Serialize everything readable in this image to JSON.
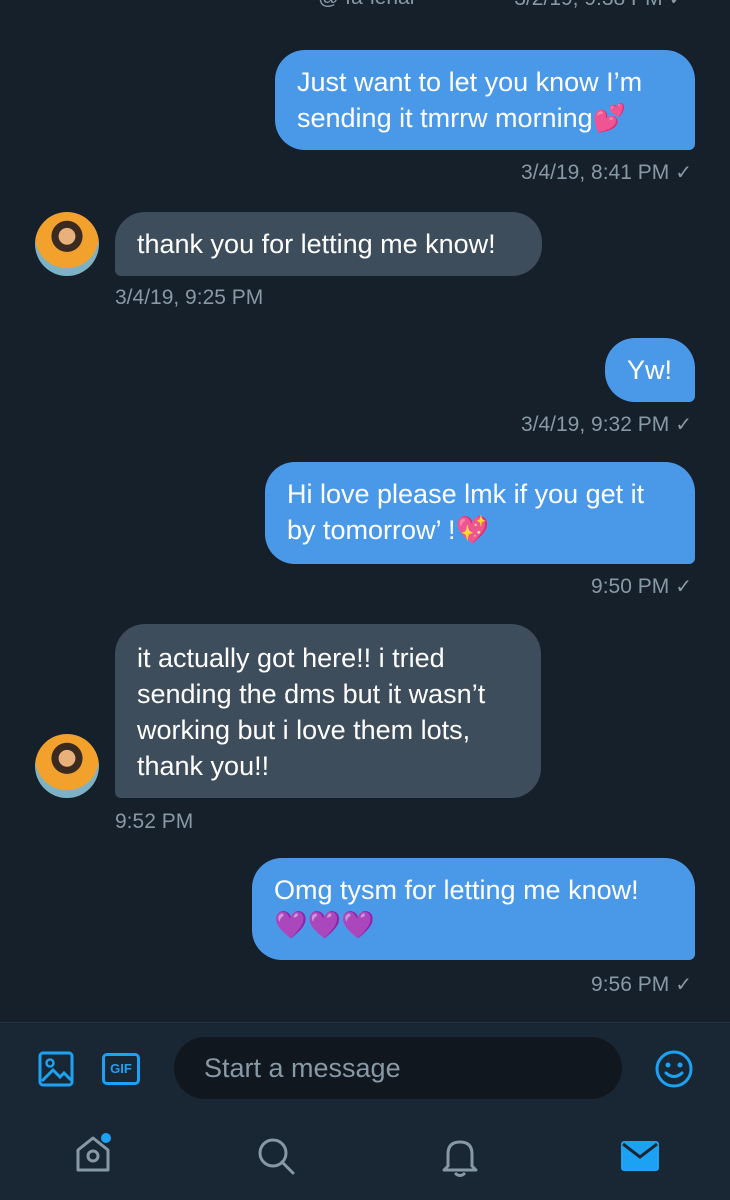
{
  "header": {
    "handle_partial": "@ fa•ienal",
    "prev_time_partial": "3/2/19, 9:38 PM ✓"
  },
  "messages": [
    {
      "direction": "out",
      "text": "Just want to let you know I’m sending it tmrrw morning",
      "emoji": "💕",
      "meta": "3/4/19, 8:41 PM"
    },
    {
      "direction": "in",
      "text": "thank you for letting me know!",
      "meta": "3/4/19, 9:25 PM"
    },
    {
      "direction": "out",
      "text": "Yw!",
      "meta": "3/4/19, 9:32 PM"
    },
    {
      "direction": "out",
      "text": "Hi love please lmk if you get it by tomorrow’ !",
      "emoji": "💖",
      "meta": "9:50 PM"
    },
    {
      "direction": "in",
      "text": "it actually got here!! i tried sending the dms but it wasn’t working but i love them lots, thank you!!",
      "meta": "9:52 PM"
    },
    {
      "direction": "out",
      "text": "Omg tysm for letting me know!",
      "emoji": "💜💜💜",
      "meta": "9:56 PM"
    }
  ],
  "read_check": "✓",
  "composer": {
    "placeholder": "Start a message",
    "gif_label": "GIF"
  },
  "colors": {
    "background": "#15202b",
    "outgoing_bubble": "#4a99e9",
    "incoming_bubble": "#3d4d5c",
    "accent": "#1da1f2",
    "muted_text": "#8899a6"
  },
  "icons": [
    "image-icon",
    "gif-icon",
    "emoji-icon",
    "home-icon",
    "search-icon",
    "notifications-icon",
    "messages-icon"
  ]
}
